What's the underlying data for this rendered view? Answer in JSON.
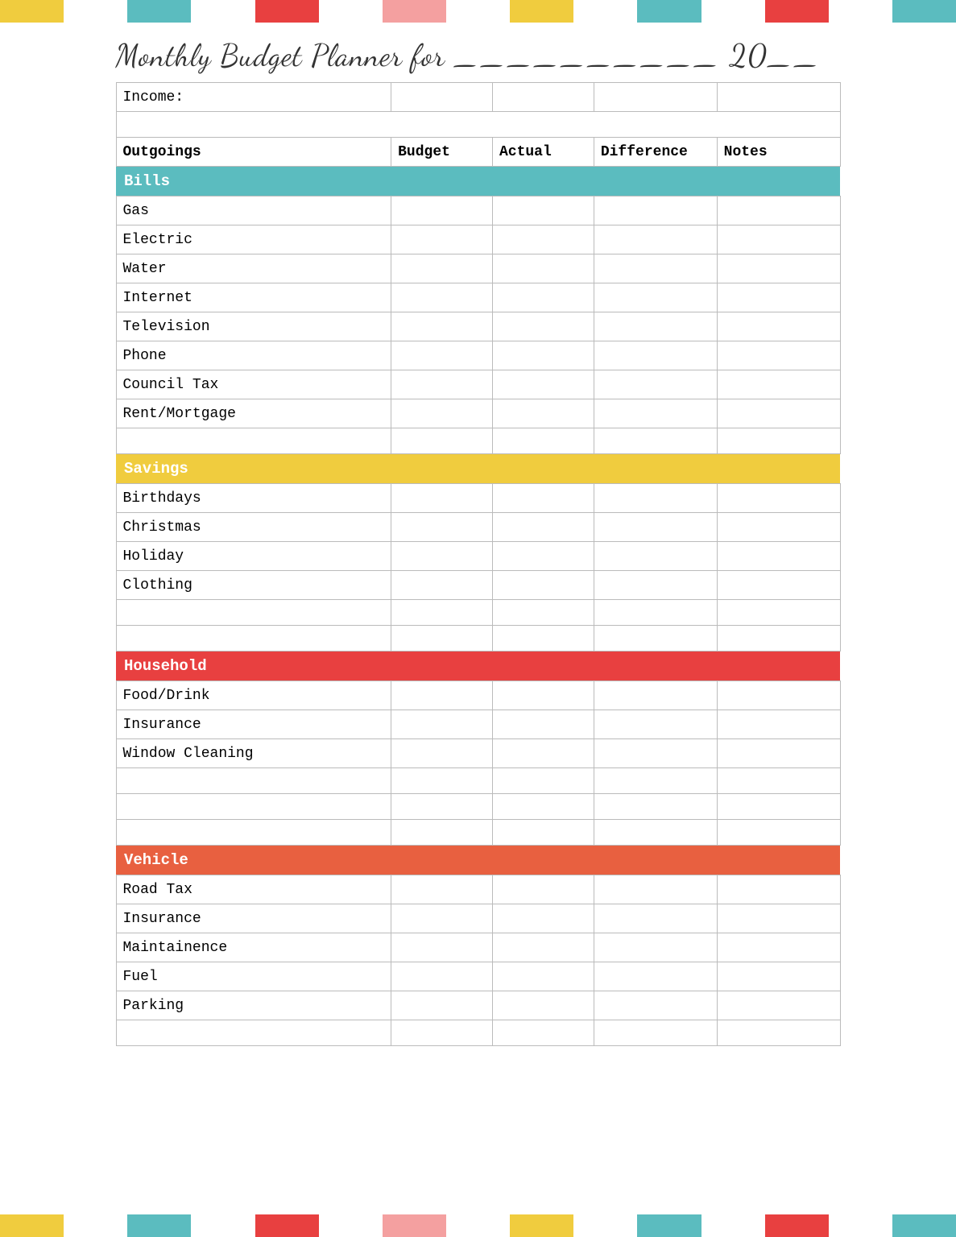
{
  "title": "Monthly Budget Planner for __________ 20__",
  "columns": {
    "label": "Outgoings",
    "budget": "Budget",
    "actual": "Actual",
    "difference": "Difference",
    "notes": "Notes"
  },
  "income_label": "Income:",
  "sections": {
    "bills": {
      "label": "Bills",
      "color": "teal",
      "rows": [
        "Gas",
        "Electric",
        "Water",
        "Internet",
        "Television",
        "Phone",
        "Council Tax",
        "Rent/Mortgage",
        ""
      ]
    },
    "savings": {
      "label": "Savings",
      "color": "yellow",
      "rows": [
        "Birthdays",
        "Christmas",
        "Holiday",
        "Clothing",
        "",
        ""
      ]
    },
    "household": {
      "label": "Household",
      "color": "red",
      "rows": [
        "Food/Drink",
        "Insurance",
        "Window Cleaning",
        "",
        "",
        ""
      ]
    },
    "vehicle": {
      "label": "Vehicle",
      "color": "salmon",
      "rows": [
        "Road Tax",
        "Insurance",
        "Maintainence",
        "Fuel",
        "Parking",
        ""
      ]
    }
  },
  "top_bars": [
    {
      "color": "#f0cc3e"
    },
    {
      "color": "#ffffff"
    },
    {
      "color": "#5bbcbf"
    },
    {
      "color": "#ffffff"
    },
    {
      "color": "#e84040"
    },
    {
      "color": "#ffffff"
    },
    {
      "color": "#f4a0a0"
    },
    {
      "color": "#ffffff"
    },
    {
      "color": "#f0cc3e"
    },
    {
      "color": "#ffffff"
    },
    {
      "color": "#5bbcbf"
    },
    {
      "color": "#ffffff"
    },
    {
      "color": "#e84040"
    },
    {
      "color": "#ffffff"
    },
    {
      "color": "#5bbcbf"
    }
  ],
  "bottom_bars": [
    {
      "color": "#f0cc3e"
    },
    {
      "color": "#ffffff"
    },
    {
      "color": "#5bbcbf"
    },
    {
      "color": "#ffffff"
    },
    {
      "color": "#e84040"
    },
    {
      "color": "#ffffff"
    },
    {
      "color": "#f4a0a0"
    },
    {
      "color": "#ffffff"
    },
    {
      "color": "#f0cc3e"
    },
    {
      "color": "#ffffff"
    },
    {
      "color": "#5bbcbf"
    },
    {
      "color": "#ffffff"
    },
    {
      "color": "#e84040"
    },
    {
      "color": "#ffffff"
    },
    {
      "color": "#5bbcbf"
    }
  ]
}
